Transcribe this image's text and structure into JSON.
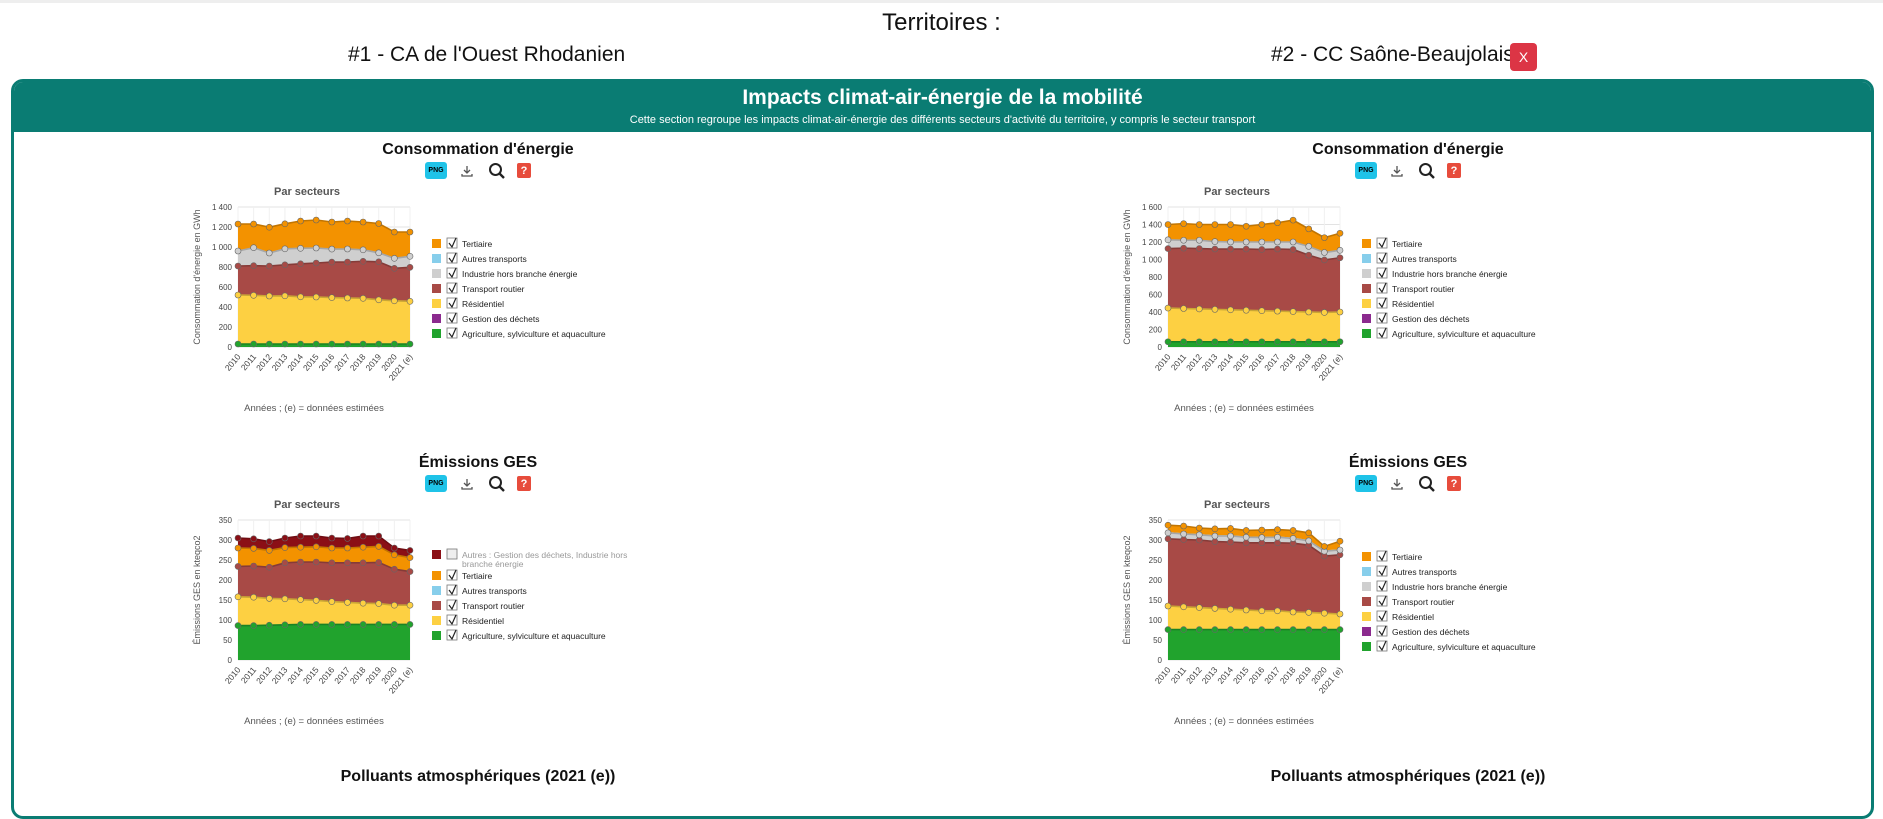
{
  "page": {
    "title": "Territoires :",
    "territories": [
      {
        "label": "#1 - CA de l'Ouest Rhodanien"
      },
      {
        "label": "#2 - CC Saône-Beaujolais"
      }
    ],
    "close_label": "X"
  },
  "section": {
    "title": "Impacts climat-air-énergie de la mobilité",
    "description": "Cette section regroupe les impacts climat-air-énergie des différents secteurs d'activité du territoire, y compris le secteur transport"
  },
  "colors": {
    "accent": "#0a7c73",
    "danger": "#dc3545",
    "png_button": "#1fc3e8",
    "help_button": "#e74c3c"
  },
  "toolbar": {
    "png_label": "PNG",
    "help_label": "?",
    "icons": [
      "download-icon",
      "magnify-icon",
      "help-icon"
    ]
  },
  "charts": {
    "conso1": {
      "title": "Consommation d'énergie"
    },
    "conso2": {
      "title": "Consommation d'énergie"
    },
    "ges1": {
      "title": "Émissions GES"
    },
    "ges2": {
      "title": "Émissions GES"
    }
  },
  "pollutants": {
    "title1": "Polluants atmosphériques (2021 (e))",
    "title2": "Polluants atmosphériques (2021 (e))"
  },
  "chart_data": [
    {
      "id": "conso1",
      "type": "area",
      "subtitle": "Par secteurs",
      "xlabel": "Années ; (e) = données estimées",
      "ylabel": "Consommation d'énergie en GWh",
      "ylim": [
        0,
        1400
      ],
      "yticks": [
        0,
        200,
        400,
        600,
        800,
        1000,
        1200,
        1400
      ],
      "categories": [
        "2010",
        "2011",
        "2012",
        "2013",
        "2014",
        "2015",
        "2016",
        "2017",
        "2018",
        "2019",
        "2020",
        "2021 (e)"
      ],
      "stacked": true,
      "legend_position": "right",
      "series": [
        {
          "name": "Agriculture, sylviculture et aquaculture",
          "color": "#21a32d",
          "values": [
            30,
            30,
            30,
            30,
            30,
            30,
            30,
            30,
            30,
            30,
            30,
            30
          ]
        },
        {
          "name": "Gestion des déchets",
          "color": "#8b2a8e",
          "values": [
            2,
            2,
            2,
            2,
            2,
            2,
            2,
            2,
            2,
            2,
            2,
            2
          ]
        },
        {
          "name": "Résidentiel",
          "color": "#fdd042",
          "values": [
            488,
            485,
            478,
            480,
            470,
            468,
            462,
            458,
            455,
            440,
            430,
            425
          ]
        },
        {
          "name": "Transport routier",
          "color": "#a84a46",
          "values": [
            290,
            296,
            300,
            310,
            330,
            340,
            355,
            360,
            370,
            380,
            325,
            340
          ]
        },
        {
          "name": "Industrie hors branche énergie",
          "color": "#cfcfcf",
          "values": [
            150,
            180,
            130,
            160,
            155,
            150,
            130,
            130,
            115,
            90,
            100,
            110
          ]
        },
        {
          "name": "Autres transports",
          "color": "#87ceeb",
          "values": [
            5,
            5,
            5,
            5,
            5,
            5,
            5,
            5,
            5,
            5,
            5,
            5
          ]
        },
        {
          "name": "Tertiaire",
          "color": "#f39200",
          "values": [
            265,
            232,
            253,
            245,
            268,
            275,
            266,
            275,
            273,
            288,
            258,
            238
          ]
        }
      ]
    },
    {
      "id": "conso2",
      "type": "area",
      "subtitle": "Par secteurs",
      "xlabel": "Années ; (e) = données estimées",
      "ylabel": "Consommation d'énergie en GWh",
      "ylim": [
        0,
        1600
      ],
      "yticks": [
        0,
        200,
        400,
        600,
        800,
        1000,
        1200,
        1400,
        1600
      ],
      "categories": [
        "2010",
        "2011",
        "2012",
        "2013",
        "2014",
        "2015",
        "2016",
        "2017",
        "2018",
        "2019",
        "2020",
        "2021 (e)"
      ],
      "stacked": true,
      "legend_position": "right",
      "series": [
        {
          "name": "Agriculture, sylviculture et aquaculture",
          "color": "#21a32d",
          "values": [
            60,
            60,
            60,
            60,
            60,
            60,
            60,
            60,
            60,
            60,
            60,
            60
          ]
        },
        {
          "name": "Gestion des déchets",
          "color": "#8b2a8e",
          "values": [
            2,
            2,
            2,
            2,
            2,
            2,
            2,
            2,
            2,
            2,
            2,
            2
          ]
        },
        {
          "name": "Résidentiel",
          "color": "#fdd042",
          "values": [
            383,
            378,
            373,
            368,
            363,
            358,
            353,
            348,
            343,
            338,
            333,
            338
          ]
        },
        {
          "name": "Transport routier",
          "color": "#a84a46",
          "values": [
            680,
            690,
            690,
            690,
            695,
            700,
            700,
            710,
            710,
            650,
            600,
            620
          ]
        },
        {
          "name": "Industrie hors branche énergie",
          "color": "#cfcfcf",
          "values": [
            100,
            90,
            95,
            85,
            80,
            80,
            85,
            80,
            85,
            100,
            85,
            85
          ]
        },
        {
          "name": "Autres transports",
          "color": "#87ceeb",
          "values": [
            5,
            5,
            5,
            5,
            5,
            5,
            5,
            5,
            5,
            5,
            5,
            5
          ]
        },
        {
          "name": "Tertiaire",
          "color": "#f39200",
          "values": [
            170,
            185,
            175,
            190,
            195,
            175,
            195,
            215,
            245,
            195,
            165,
            190
          ]
        }
      ]
    },
    {
      "id": "ges1",
      "type": "area",
      "subtitle": "Par secteurs",
      "xlabel": "Années ; (e) = données estimées",
      "ylabel": "Émissions GES en kteqco2",
      "ylim": [
        0,
        350
      ],
      "yticks": [
        0,
        50,
        100,
        150,
        200,
        250,
        300,
        350
      ],
      "categories": [
        "2010",
        "2011",
        "2012",
        "2013",
        "2014",
        "2015",
        "2016",
        "2017",
        "2018",
        "2019",
        "2020",
        "2021 (e)"
      ],
      "stacked": true,
      "legend_position": "right",
      "series": [
        {
          "name": "Agriculture, sylviculture et aquaculture",
          "color": "#21a32d",
          "values": [
            86,
            86,
            87,
            88,
            89,
            89,
            89,
            89,
            89,
            89,
            89,
            89
          ]
        },
        {
          "name": "Résidentiel",
          "color": "#fdd042",
          "values": [
            72,
            71,
            67,
            65,
            62,
            60,
            57,
            55,
            53,
            52,
            48,
            48
          ]
        },
        {
          "name": "Transport routier",
          "color": "#a84a46",
          "values": [
            76,
            78,
            78,
            90,
            94,
            96,
            97,
            99,
            101,
            103,
            90,
            84
          ]
        },
        {
          "name": "Autres transports",
          "color": "#87ceeb",
          "values": [
            1,
            1,
            1,
            1,
            1,
            1,
            1,
            1,
            1,
            1,
            1,
            1
          ]
        },
        {
          "name": "Tertiaire",
          "color": "#f39200",
          "values": [
            45,
            43,
            41,
            37,
            36,
            37,
            36,
            36,
            38,
            39,
            35,
            34
          ]
        },
        {
          "name": "Autres : Gestion des déchets, Industrie hors branche énergie",
          "color": "#8b0f16",
          "values": [
            25,
            24,
            22,
            24,
            28,
            27,
            25,
            24,
            28,
            26,
            17,
            18
          ],
          "hidden": true
        }
      ]
    },
    {
      "id": "ges2",
      "type": "area",
      "subtitle": "Par secteurs",
      "xlabel": "Années ; (e) = données estimées",
      "ylabel": "Émissions GES en kteqco2",
      "ylim": [
        0,
        350
      ],
      "yticks": [
        0,
        50,
        100,
        150,
        200,
        250,
        300,
        350
      ],
      "categories": [
        "2010",
        "2011",
        "2012",
        "2013",
        "2014",
        "2015",
        "2016",
        "2017",
        "2018",
        "2019",
        "2020",
        "2021 (e)"
      ],
      "stacked": true,
      "legend_position": "right",
      "series": [
        {
          "name": "Agriculture, sylviculture et aquaculture",
          "color": "#21a32d",
          "values": [
            76,
            76,
            76,
            76,
            76,
            76,
            76,
            76,
            76,
            76,
            76,
            76
          ]
        },
        {
          "name": "Gestion des déchets",
          "color": "#8b2a8e",
          "values": [
            1,
            1,
            1,
            1,
            1,
            1,
            1,
            1,
            1,
            1,
            1,
            1
          ]
        },
        {
          "name": "Résidentiel",
          "color": "#fdd042",
          "values": [
            58,
            56,
            54,
            52,
            50,
            48,
            46,
            46,
            43,
            42,
            40,
            38
          ]
        },
        {
          "name": "Transport routier",
          "color": "#a84a46",
          "values": [
            168,
            168,
            169,
            167,
            168,
            168,
            170,
            170,
            172,
            168,
            143,
            148
          ]
        },
        {
          "name": "Industrie hors branche énergie",
          "color": "#cfcfcf",
          "values": [
            15,
            14,
            13,
            14,
            15,
            14,
            13,
            14,
            12,
            11,
            12,
            12
          ]
        },
        {
          "name": "Autres transports",
          "color": "#87ceeb",
          "values": [
            2,
            2,
            2,
            2,
            2,
            2,
            2,
            2,
            2,
            2,
            2,
            2
          ]
        },
        {
          "name": "Tertiaire",
          "color": "#f39200",
          "values": [
            17,
            18,
            15,
            16,
            17,
            15,
            17,
            17,
            18,
            18,
            10,
            20
          ]
        }
      ]
    }
  ]
}
